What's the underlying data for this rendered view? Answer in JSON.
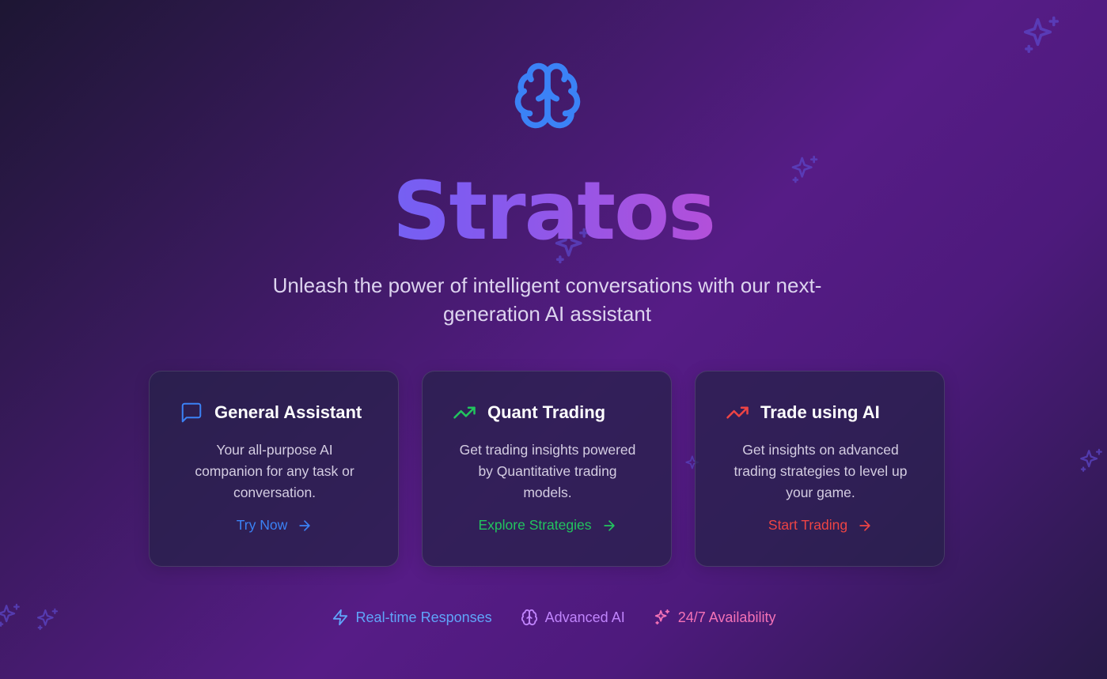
{
  "colors": {
    "blue": "#3b82f6",
    "green": "#22c55e",
    "red": "#ef4444",
    "purple": "#c084fc",
    "pink": "#ec4899",
    "sparkle": "#5b46c7"
  },
  "hero": {
    "logo_icon": "brain-icon",
    "title": "Stratos",
    "subtitle": "Unleash the power of intelligent conversations with our next-generation AI assistant"
  },
  "cards": [
    {
      "icon": "message-square-icon",
      "title": "General Assistant",
      "description": "Your all-purpose AI companion for any task or conversation.",
      "link_label": "Try Now",
      "accent": "#3b82f6"
    },
    {
      "icon": "trending-up-icon",
      "title": "Quant Trading",
      "description": "Get trading insights powered by Quantitative trading models.",
      "link_label": "Explore Strategies",
      "accent": "#22c55e"
    },
    {
      "icon": "trending-up-icon",
      "title": "Trade using AI",
      "description": "Get insights on advanced trading strategies to level up your game.",
      "link_label": "Start Trading",
      "accent": "#ef4444"
    }
  ],
  "features": [
    {
      "icon": "zap-icon",
      "label": "Real-time Responses",
      "color": "#60a5fa"
    },
    {
      "icon": "brain-icon",
      "label": "Advanced AI",
      "color": "#c084fc"
    },
    {
      "icon": "sparkles-icon",
      "label": "24/7 Availability",
      "color": "#f472b6"
    }
  ]
}
